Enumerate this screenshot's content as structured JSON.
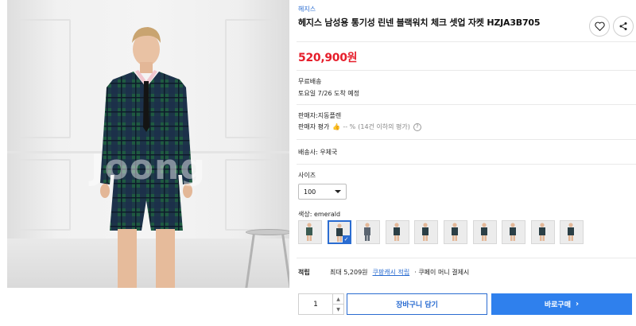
{
  "product": {
    "brand": "헤지스",
    "title": "헤지스 남성용 통기성 린넨 블랙워치 체크 셋업 자켓 HZJA3B705",
    "price": "520,900원",
    "image_watermark": "Joong"
  },
  "shipping": {
    "label": "무료배송",
    "eta": "토요일 7/26 도착 예정"
  },
  "seller": {
    "label": "판매자:지동플렌",
    "rating_label": "판매자 평가",
    "rating_value": "-- %",
    "rating_note": "(14건 이하의 평가)"
  },
  "delivery": {
    "label": "배송사: 우체국"
  },
  "size": {
    "label": "사이즈",
    "selected": "100"
  },
  "color": {
    "label": "색상: emerald",
    "swatch_count": 10,
    "selected_index": 1
  },
  "points": {
    "label": "적립",
    "max_text": "최대 5,209원",
    "cash_link": "쿠팡캐시 적립",
    "extra": "· 쿠페이 머니 결제시"
  },
  "purchase": {
    "quantity": "1",
    "cart_label": "장바구니 담기",
    "buy_label": "바로구매"
  },
  "colors": {
    "accent": "#2a6cd1",
    "price": "#e61e2b",
    "buy_button": "#2f80ed"
  }
}
